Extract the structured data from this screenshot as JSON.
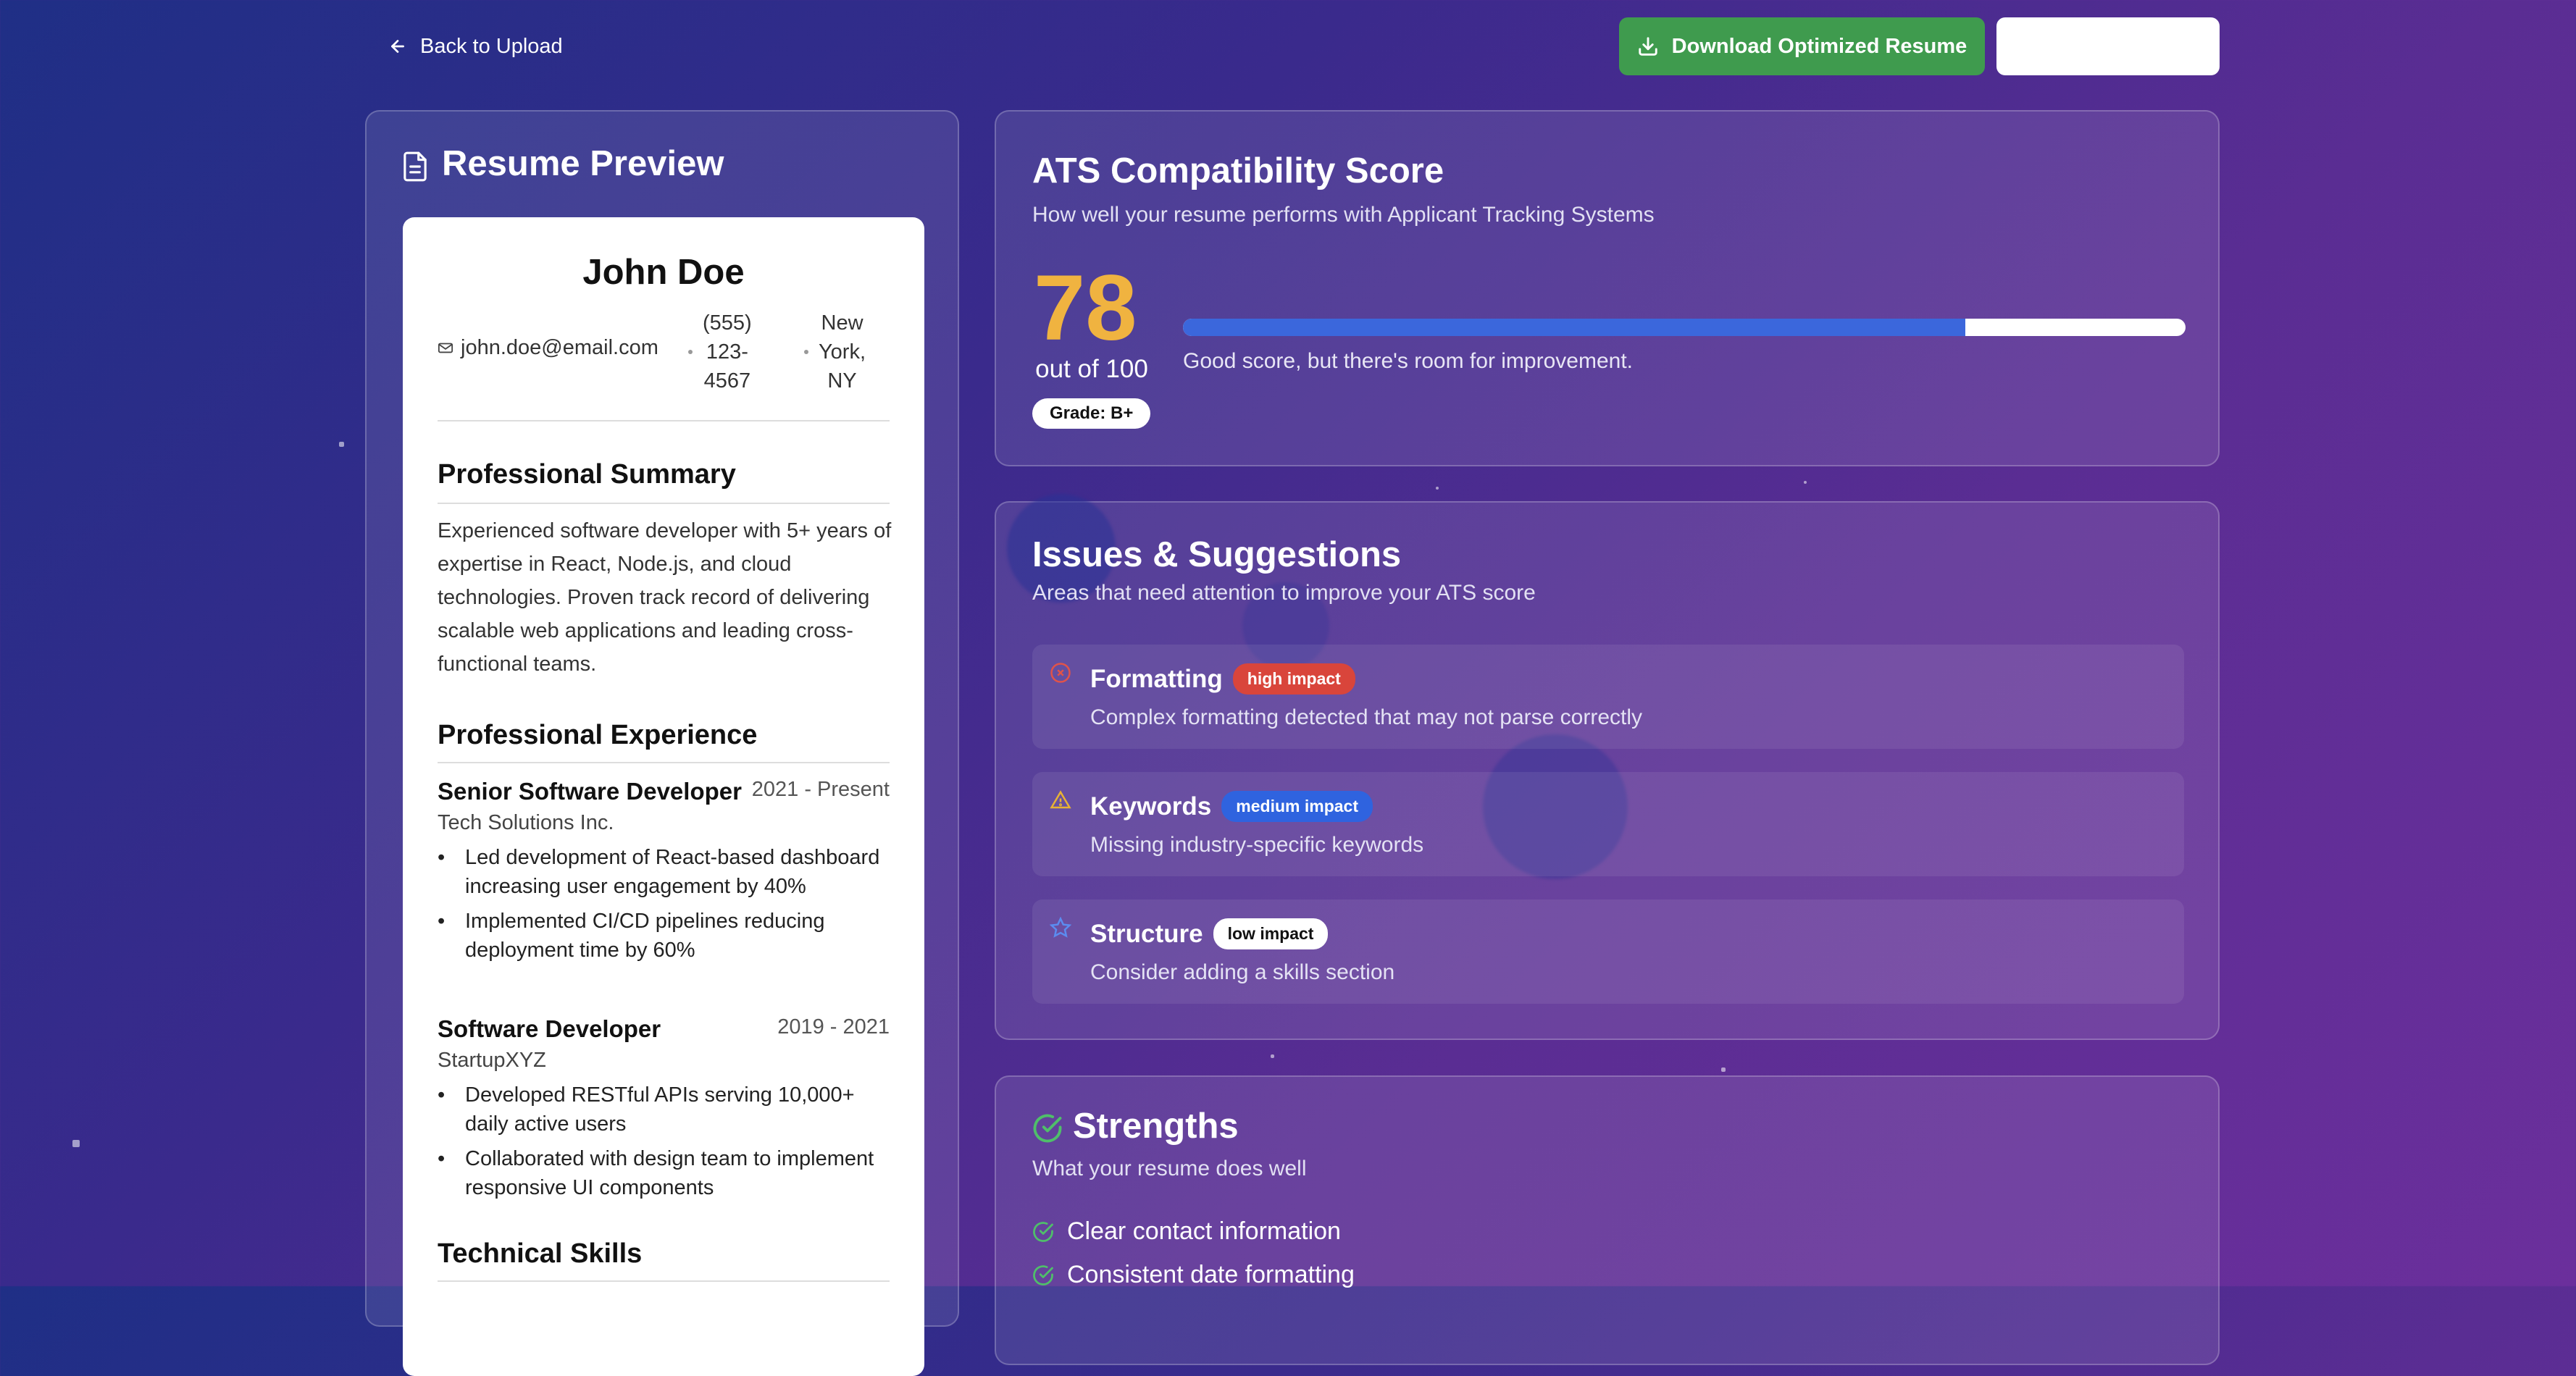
{
  "nav": {
    "back_label": "Back to Upload"
  },
  "actions": {
    "download_label": "Download Optimized Resume",
    "secondary_label": ""
  },
  "resume_preview": {
    "title": "Resume Preview",
    "name": "John Doe",
    "contact": {
      "email": "john.doe@email.com",
      "phone_lines": [
        "(555)",
        "123-",
        "4567"
      ],
      "location_lines": [
        "New",
        "York,",
        "NY"
      ]
    },
    "summary_title": "Professional Summary",
    "summary": "Experienced software developer with 5+ years of expertise in React, Node.js, and cloud technologies. Proven track record of delivering scalable web applications and leading cross-functional teams.",
    "experience_title": "Professional Experience",
    "jobs": [
      {
        "title": "Senior Software Developer",
        "dates": "2021 - Present",
        "company": "Tech Solutions Inc.",
        "bullets": [
          "Led development of React-based dashboard increasing user engagement by 40%",
          "Implemented CI/CD pipelines reducing deployment time by 60%"
        ]
      },
      {
        "title": "Software Developer",
        "dates": "2019 - 2021",
        "company": "StartupXYZ",
        "bullets": [
          "Developed RESTful APIs serving 10,000+ daily active users",
          "Collaborated with design team to implement responsive UI components"
        ]
      }
    ],
    "skills_title": "Technical Skills"
  },
  "ats": {
    "title": "ATS Compatibility Score",
    "subtitle": "How well your resume performs with Applicant Tracking Systems",
    "score": "78",
    "out_of": "out of 100",
    "grade": "Grade: B+",
    "progress_fraction": 0.78,
    "message": "Good score, but there's room for improvement.",
    "bar_color": "#3b67dc",
    "score_color": "#f0b340"
  },
  "issues": {
    "title": "Issues & Suggestions",
    "subtitle": "Areas that need attention to improve your ATS score",
    "items": [
      {
        "title": "Formatting",
        "impact": "high impact",
        "description": "Complex formatting detected that may not parse correctly",
        "icon": "x-circle-icon",
        "badge_color": "#d9453b",
        "icon_color": "#e0534a"
      },
      {
        "title": "Keywords",
        "impact": "medium impact",
        "description": "Missing industry-specific keywords",
        "icon": "warning-triangle-icon",
        "badge_color": "#2f63df",
        "icon_color": "#e8b234"
      },
      {
        "title": "Structure",
        "impact": "low impact",
        "description": "Consider adding a skills section",
        "icon": "star-icon",
        "badge_color": "#ffffff",
        "icon_color": "#5b8cf0"
      }
    ]
  },
  "strengths": {
    "title": "Strengths",
    "subtitle": "What your resume does well",
    "items": [
      "Clear contact information",
      "Consistent date formatting"
    ]
  },
  "colors": {
    "download_button": "#3f9b4e",
    "strength_check": "#4fbf6a"
  }
}
